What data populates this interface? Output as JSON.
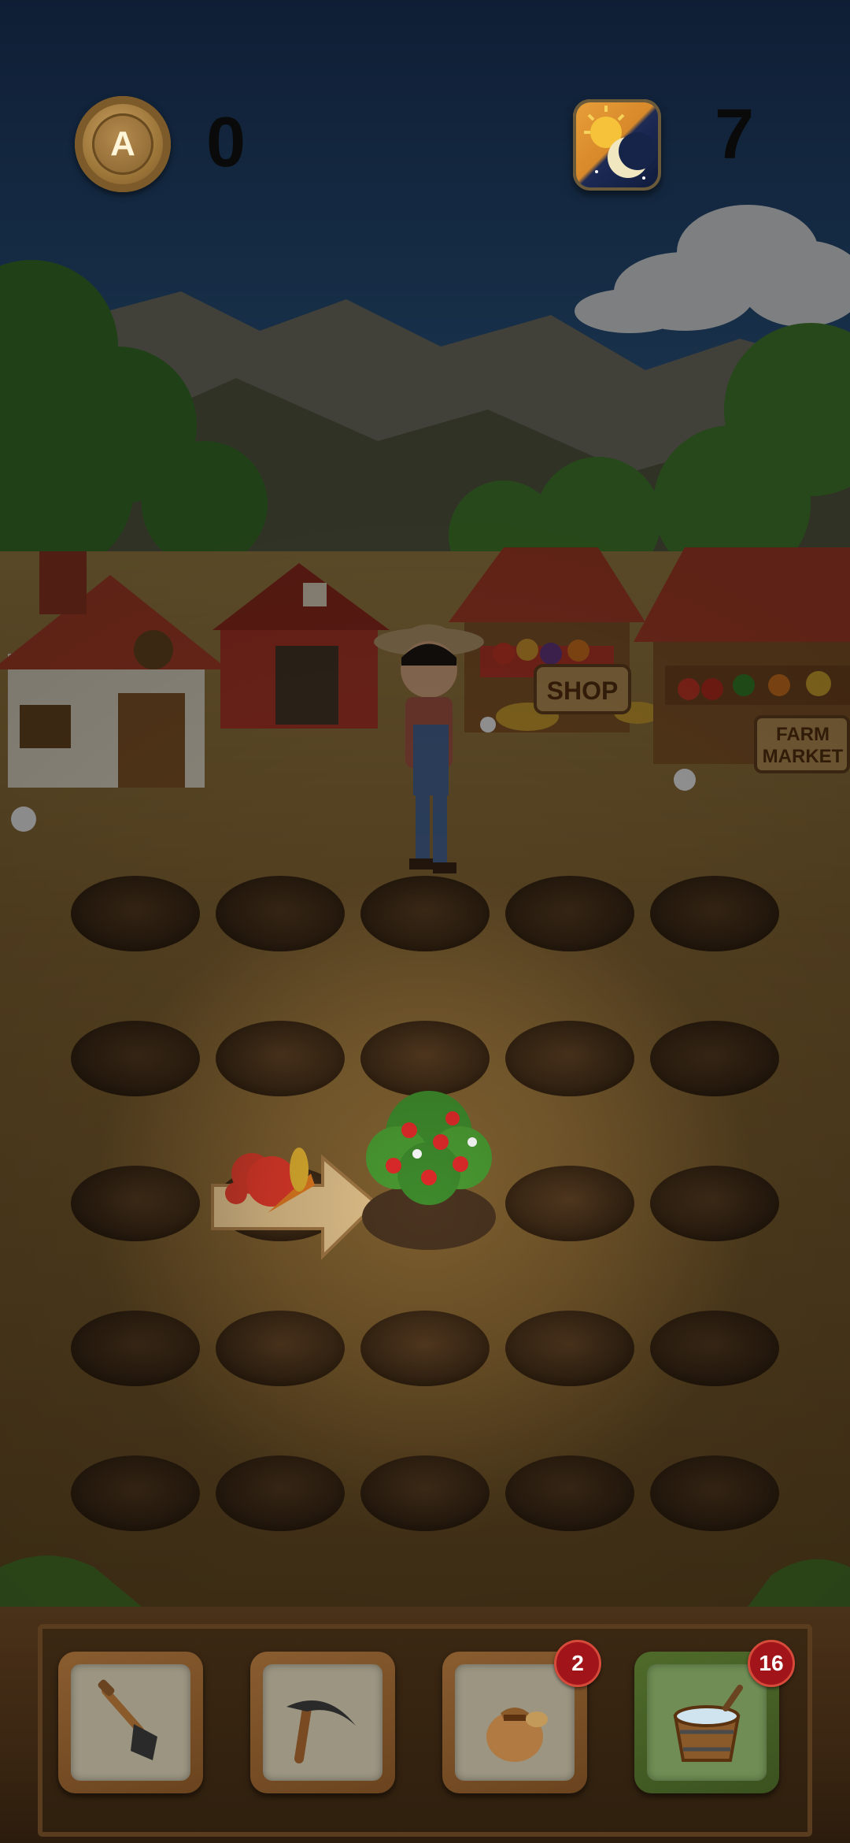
{
  "hud": {
    "coin_icon_letter": "A",
    "coins": "0",
    "day": "7"
  },
  "signs": {
    "shop": "SHOP",
    "market_line1": "FARM",
    "market_line2": "MARKET"
  },
  "field": {
    "rows": 5,
    "cols": 5,
    "highlighted_plot": {
      "row": 3,
      "col": 3,
      "crop": "strawberry-plant"
    },
    "hint": "arrow-pointing-at-plot"
  },
  "toolbar": {
    "slots": [
      {
        "tool": "shovel",
        "badge": null,
        "active": false
      },
      {
        "tool": "sickle",
        "badge": null,
        "active": false
      },
      {
        "tool": "seed-bag",
        "badge": "2",
        "active": false
      },
      {
        "tool": "water-bucket",
        "badge": "16",
        "active": true
      }
    ]
  },
  "colors": {
    "sky": "#1f3f6b",
    "soil": "#3b2a1a",
    "badge": "#a0141a",
    "active_slot": "#4f6b2a"
  }
}
